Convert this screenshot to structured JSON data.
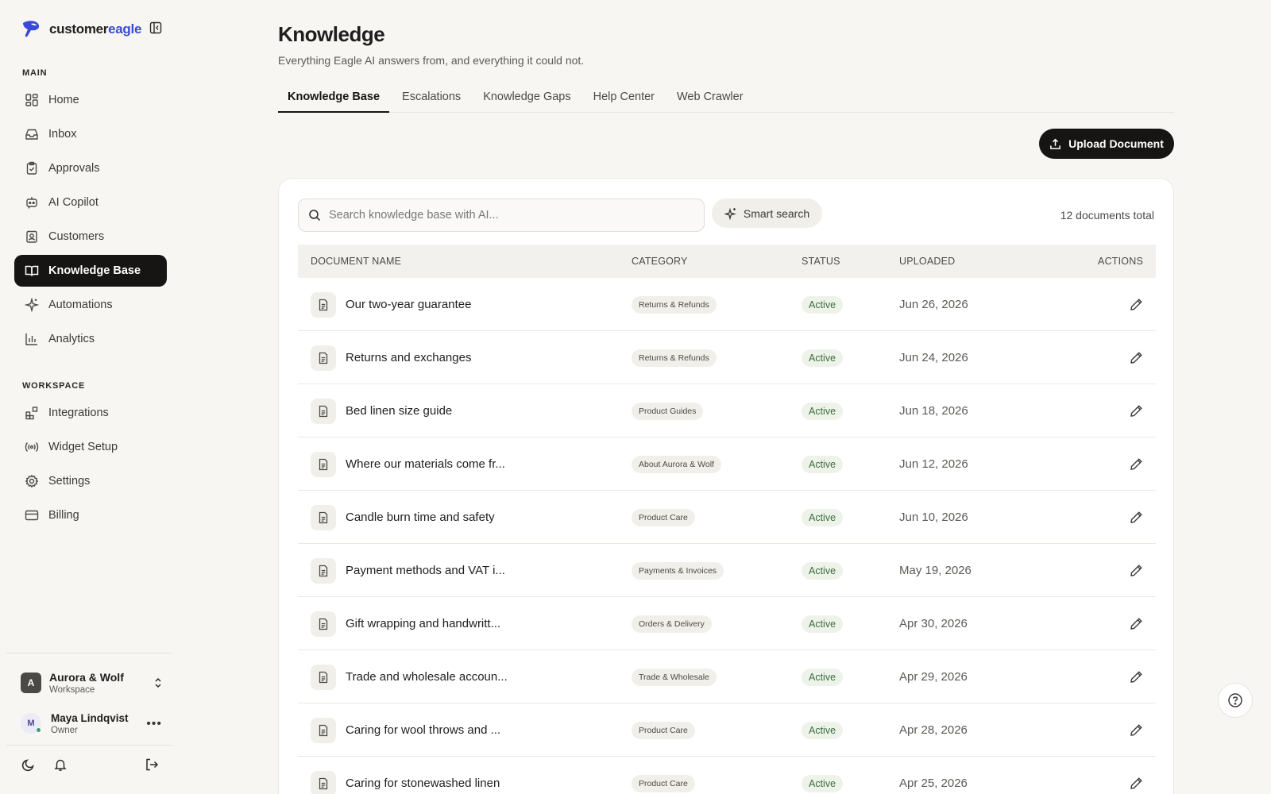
{
  "brand": {
    "name_part1": "customer",
    "name_part2": "eagle",
    "accent_color": "#3a49d8"
  },
  "sidebar": {
    "main_label": "MAIN",
    "main_items": [
      {
        "label": "Home",
        "icon": "grid-icon"
      },
      {
        "label": "Inbox",
        "icon": "inbox-icon"
      },
      {
        "label": "Approvals",
        "icon": "clipboard-check-icon"
      },
      {
        "label": "AI Copilot",
        "icon": "bot-icon"
      },
      {
        "label": "Customers",
        "icon": "contact-icon"
      },
      {
        "label": "Knowledge Base",
        "icon": "book-open-icon",
        "active": true
      },
      {
        "label": "Automations",
        "icon": "sparkle-icon"
      },
      {
        "label": "Analytics",
        "icon": "bar-chart-icon"
      }
    ],
    "workspace_label": "WORKSPACE",
    "workspace_items": [
      {
        "label": "Integrations",
        "icon": "blocks-icon"
      },
      {
        "label": "Widget Setup",
        "icon": "broadcast-icon"
      },
      {
        "label": "Settings",
        "icon": "gear-icon"
      },
      {
        "label": "Billing",
        "icon": "credit-card-icon"
      }
    ],
    "workspace": {
      "avatar": "A",
      "name": "Aurora & Wolf",
      "sub": "Workspace"
    },
    "user": {
      "avatar": "M",
      "name": "Maya Lindqvist",
      "role": "Owner"
    }
  },
  "page": {
    "title": "Knowledge",
    "subtitle": "Everything Eagle AI answers from, and everything it could not.",
    "tabs": [
      {
        "label": "Knowledge Base",
        "active": true
      },
      {
        "label": "Escalations"
      },
      {
        "label": "Knowledge Gaps"
      },
      {
        "label": "Help Center"
      },
      {
        "label": "Web Crawler"
      }
    ],
    "upload_label": "Upload Document"
  },
  "search": {
    "placeholder": "Search knowledge base with AI...",
    "smart_label": "Smart search",
    "count_text": "12 documents total"
  },
  "table": {
    "headers": {
      "name": "DOCUMENT NAME",
      "category": "CATEGORY",
      "status": "STATUS",
      "uploaded": "UPLOADED",
      "actions": "ACTIONS"
    },
    "rows": [
      {
        "name": "Our two-year guarantee",
        "category": "Returns & Refunds",
        "status": "Active",
        "uploaded": "Jun 26, 2026"
      },
      {
        "name": "Returns and exchanges",
        "category": "Returns & Refunds",
        "status": "Active",
        "uploaded": "Jun 24, 2026"
      },
      {
        "name": "Bed linen size guide",
        "category": "Product Guides",
        "status": "Active",
        "uploaded": "Jun 18, 2026"
      },
      {
        "name": "Where our materials come fr...",
        "category": "About Aurora & Wolf",
        "status": "Active",
        "uploaded": "Jun 12, 2026"
      },
      {
        "name": "Candle burn time and safety",
        "category": "Product Care",
        "status": "Active",
        "uploaded": "Jun 10, 2026"
      },
      {
        "name": "Payment methods and VAT i...",
        "category": "Payments & Invoices",
        "status": "Active",
        "uploaded": "May 19, 2026"
      },
      {
        "name": "Gift wrapping and handwritt...",
        "category": "Orders & Delivery",
        "status": "Active",
        "uploaded": "Apr 30, 2026"
      },
      {
        "name": "Trade and wholesale accoun...",
        "category": "Trade & Wholesale",
        "status": "Active",
        "uploaded": "Apr 29, 2026"
      },
      {
        "name": "Caring for wool throws and ...",
        "category": "Product Care",
        "status": "Active",
        "uploaded": "Apr 28, 2026"
      },
      {
        "name": "Caring for stonewashed linen",
        "category": "Product Care",
        "status": "Active",
        "uploaded": "Apr 25, 2026"
      }
    ]
  }
}
